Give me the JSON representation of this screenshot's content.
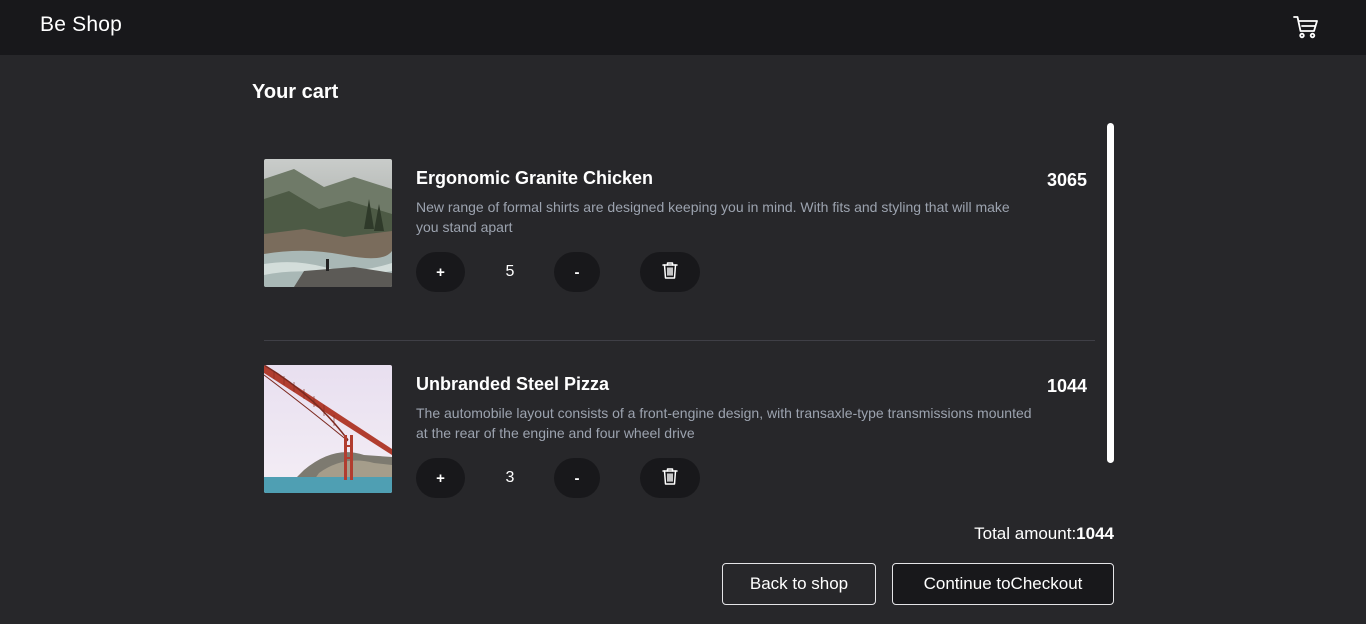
{
  "header": {
    "brand": "Be Shop",
    "cart_icon": "shopping-cart-icon"
  },
  "cart": {
    "title": "Your cart",
    "items": [
      {
        "name": "Ergonomic Granite Chicken",
        "price": "3065",
        "description": "New range of formal shirts are designed keeping you in mind. With fits and styling that will make you stand apart",
        "quantity": "5",
        "plus_label": "+",
        "minus_label": "-",
        "image": "misty-river-landscape-photo",
        "delete_icon": "trash-icon"
      },
      {
        "name": "Unbranded Steel Pizza",
        "price": "1044",
        "description": "The automobile layout consists of a front-engine design, with transaxle-type transmissions mounted at the rear of the engine and four wheel drive",
        "quantity": "3",
        "plus_label": "+",
        "minus_label": "-",
        "image": "suspension-bridge-photo",
        "delete_icon": "trash-icon"
      }
    ],
    "total_label": "Total amount:",
    "total_value": "1044",
    "back_button": "Back to shop",
    "checkout_button": "Continue toCheckout"
  },
  "colors": {
    "background": "#27272a",
    "header": "#18181b",
    "control": "#18181b",
    "muted_text": "#9ca3af"
  }
}
